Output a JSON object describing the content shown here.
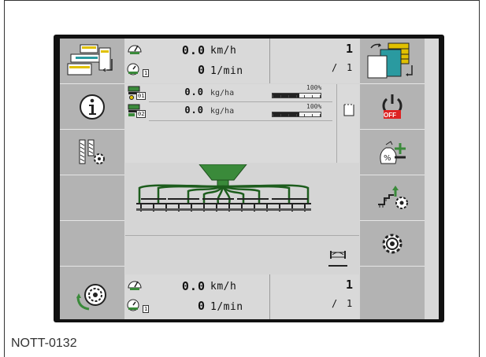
{
  "caption": "NOTT-0132",
  "colors": {
    "accent_green": "#3a8a3a",
    "softkey_gray": "#b3b3b3",
    "off_red": "#d22"
  },
  "top": {
    "speed_value": "0.0",
    "speed_unit": "km/h",
    "rpm_value": "0",
    "rpm_unit": "1/min",
    "counter_value": "1",
    "counter_sub": "1",
    "rpm_tag": "1"
  },
  "rates": [
    {
      "tag": "01",
      "value": "0.0",
      "unit": "kg/ha",
      "percent": "100%",
      "fill_fraction": 0.55
    },
    {
      "tag": "02",
      "value": "0.0",
      "unit": "kg/ha",
      "percent": "100%",
      "fill_fraction": 0.55
    }
  ],
  "bottom": {
    "speed_value": "0.0",
    "speed_unit": "km/h",
    "rpm_value": "0",
    "rpm_unit": "1/min",
    "counter_value": "1",
    "counter_sub": "1",
    "rpm_tag": "1"
  },
  "off_label": "OFF",
  "icons": {
    "left": [
      "menu-switch-icon",
      "info-icon",
      "tramline-settings-icon",
      "empty",
      "empty",
      "drive-wheel-icon"
    ],
    "right": [
      "menu-switch-icon",
      "power-off-icon",
      "rate-plus-icon",
      "hydraulics-settings-icon",
      "settings-gear-icon",
      "empty"
    ]
  }
}
